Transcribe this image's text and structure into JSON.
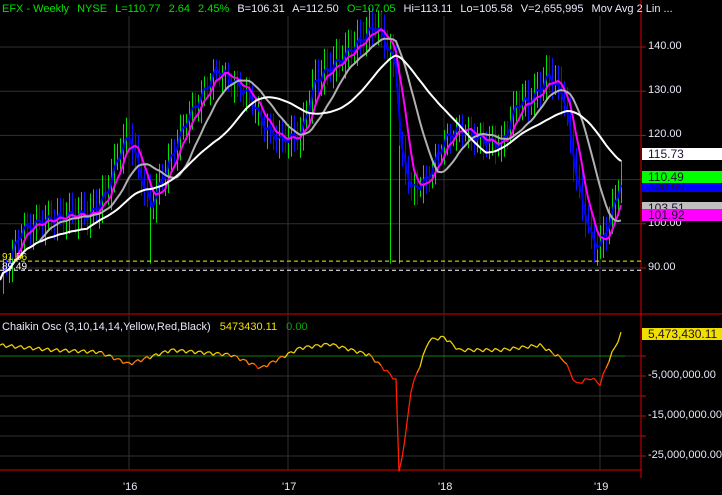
{
  "header": {
    "symbol": "EFX - Weekly",
    "exchange": "NYSE",
    "last": "L=110.77",
    "change": "2.64",
    "change_pct": "2.45%",
    "bid": "B=106.31",
    "ask": "A=112.50",
    "open": "O=107.05",
    "high": "Hi=113.11",
    "low": "Lo=105.58",
    "volume": "V=2,655,995",
    "study": "Mov Avg 2 Lin ..."
  },
  "price_axis": {
    "labels": [
      "140.00",
      "130.00",
      "120.00",
      "110.00",
      "100.00",
      "90.00"
    ],
    "values": [
      140,
      130,
      120,
      110,
      100,
      90
    ]
  },
  "price_tags": [
    {
      "text": "115.73",
      "value": 115.73,
      "bg": "#ffffff"
    },
    {
      "text": "108.66",
      "value": 108.66,
      "bg": "#0000ff"
    },
    {
      "text": "110.49",
      "value": 110.49,
      "bg": "#00ff00"
    },
    {
      "text": "103.51",
      "value": 103.51,
      "bg": "#c0c0c0"
    },
    {
      "text": "101.92",
      "value": 101.92,
      "bg": "#ff00ff"
    }
  ],
  "levels": [
    {
      "text": "91.56",
      "value": 91.56,
      "color": "#f0f000"
    },
    {
      "text": "89.49",
      "value": 89.49,
      "color": "#ffffff"
    }
  ],
  "indicator": {
    "title": "Chaikin Osc (3,10,14,14,Yellow,Red,Black)",
    "value": "5473430.11",
    "signal": "0.00",
    "tag": "5,473,430.11",
    "axis_labels": [
      "-5,000,000.00",
      "-15,000,000.00",
      "-25,000,000.00"
    ],
    "axis_values": [
      -5,
      -15,
      -25
    ]
  },
  "x_axis": {
    "labels": [
      {
        "text": "'16",
        "week": 43
      },
      {
        "text": "'17",
        "week": 96
      },
      {
        "text": "'18",
        "week": 148
      },
      {
        "text": "'19",
        "week": 200
      }
    ]
  },
  "chart_data": {
    "type": "line",
    "price_keypoints_week": [
      0,
      7,
      13,
      23,
      30,
      35,
      40,
      43,
      47,
      50,
      55,
      62,
      67,
      72,
      77,
      83,
      88,
      93,
      100,
      105,
      113,
      120,
      125,
      128,
      132,
      133,
      137,
      142,
      148,
      153,
      160,
      167,
      172,
      177,
      183,
      188,
      192,
      197,
      200,
      205,
      207
    ],
    "price_keypoints_close": [
      87.3,
      98.6,
      100.4,
      102,
      102,
      106.5,
      116.7,
      120,
      110,
      104,
      112,
      123.5,
      129,
      135,
      132.5,
      129,
      122,
      119,
      120,
      132.5,
      137,
      141.5,
      145,
      141.5,
      135,
      117.8,
      107.6,
      110,
      119,
      122,
      119,
      117.8,
      127,
      128,
      133.7,
      128,
      110,
      96.3,
      95,
      105,
      111
    ],
    "chaikin_keypoints_week": [
      0,
      17,
      33,
      43,
      57,
      77,
      87,
      100,
      110,
      123,
      132,
      133,
      135,
      137,
      143,
      148,
      153,
      167,
      180,
      188,
      192,
      197,
      200,
      203,
      207
    ],
    "chaikin_keypoints_millions": [
      2.7,
      1.5,
      1,
      -2,
      1.5,
      0.3,
      -3,
      2,
      3,
      0.3,
      -6,
      -29,
      -21,
      -8.5,
      4,
      4.7,
      1.5,
      1.5,
      2.7,
      -1,
      -7,
      -5.5,
      -7,
      -1,
      5.5
    ],
    "moving_averages": [
      {
        "name": "fast",
        "color": "#0000ff"
      },
      {
        "name": "mid",
        "color": "#ff00ff"
      },
      {
        "name": "slow",
        "color": "#b0b0b0"
      },
      {
        "name": "long",
        "color": "#ffffff"
      }
    ]
  }
}
